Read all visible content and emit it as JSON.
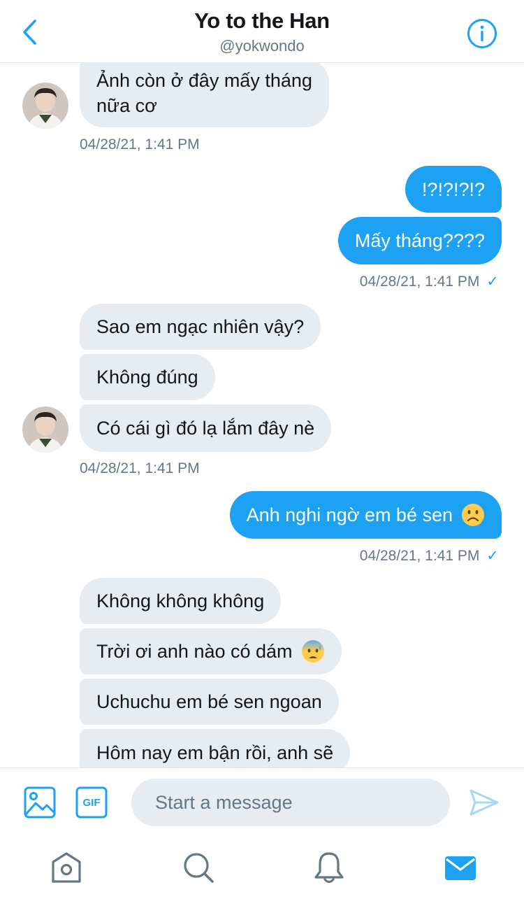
{
  "header": {
    "title": "Yo to the Han",
    "handle": "@yokwondo",
    "back_icon": "chevron-left-icon",
    "info_icon": "info-icon"
  },
  "colors": {
    "accent": "#1da1f2",
    "incoming_bubble": "#e6ecf0",
    "secondary_text": "#657786"
  },
  "messages": [
    {
      "side": "in",
      "text": "Ảnh còn ở đây mấy tháng",
      "text2": "nữa cơ"
    },
    {
      "side": "in",
      "timestamp": "04/28/21, 1:41 PM"
    },
    {
      "side": "out",
      "text": "!?!?!?!?"
    },
    {
      "side": "out",
      "text": "Mấy tháng????"
    },
    {
      "side": "out",
      "timestamp": "04/28/21, 1:41 PM",
      "status": "✓"
    },
    {
      "side": "in",
      "text": "Sao em ngạc nhiên vậy?"
    },
    {
      "side": "in",
      "text": "Không đúng"
    },
    {
      "side": "in",
      "text": "Có cái gì đó lạ lắm đây nè"
    },
    {
      "side": "in",
      "timestamp": "04/28/21, 1:41 PM"
    },
    {
      "side": "out",
      "text": "Anh nghi ngờ em bé sen",
      "emoji": "frowning-face"
    },
    {
      "side": "out",
      "timestamp": "04/28/21, 1:41 PM",
      "status": "✓"
    },
    {
      "side": "in",
      "text": "Không không không"
    },
    {
      "side": "in",
      "text": "Trời ơi anh nào có dám",
      "emoji": "anxious-face-with-sweat"
    },
    {
      "side": "in",
      "text": "Uchuchu em bé sen ngoan"
    },
    {
      "side": "in",
      "text": "Hôm nay em bận rồi, anh sẽ"
    }
  ],
  "composer": {
    "placeholder": "Start a message",
    "gif_label": "GIF",
    "image_icon": "image-icon",
    "gif_icon": "gif-icon",
    "send_icon": "send-icon"
  },
  "tabs": [
    {
      "name": "home",
      "icon": "home-icon"
    },
    {
      "name": "search",
      "icon": "search-icon"
    },
    {
      "name": "notifications",
      "icon": "bell-icon"
    },
    {
      "name": "messages",
      "icon": "mail-icon",
      "active": true
    }
  ]
}
